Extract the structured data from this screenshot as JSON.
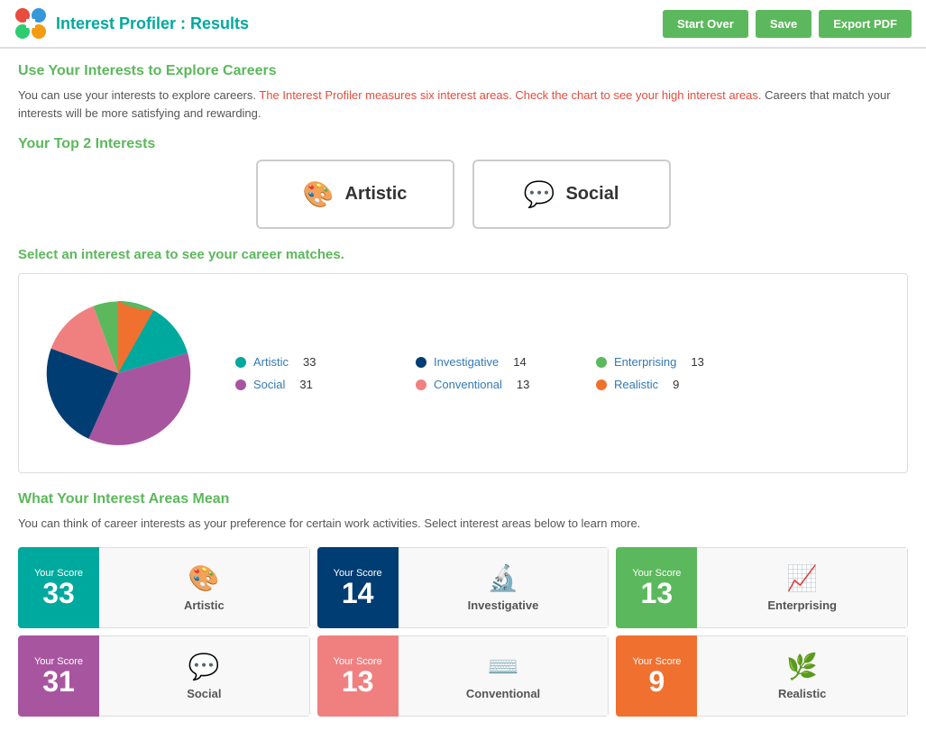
{
  "header": {
    "title": "Interest Profiler : Results",
    "buttons": {
      "start_over": "Start Over",
      "save": "Save",
      "export_pdf": "Export PDF"
    }
  },
  "intro": {
    "section_title": "Use Your Interests to Explore Careers",
    "description_plain": "You can use your interests to explore careers. ",
    "description_highlight": "The Interest Profiler measures six interest areas. Check the chart to see your high interest areas.",
    "description_end": " Careers that match your interests will be more satisfying and rewarding."
  },
  "top_interests": {
    "section_title": "Your Top 2 Interests",
    "items": [
      {
        "label": "Artistic",
        "icon": "🎨"
      },
      {
        "label": "Social",
        "icon": "💬"
      }
    ]
  },
  "select_label": "Select an interest area to see your career matches.",
  "chart": {
    "legend": [
      {
        "label": "Artistic",
        "value": 33,
        "color": "#00a99d"
      },
      {
        "label": "Social",
        "value": 31,
        "color": "#a855a0"
      },
      {
        "label": "Investigative",
        "value": 14,
        "color": "#003d73"
      },
      {
        "label": "Conventional",
        "value": 13,
        "color": "#f08080"
      },
      {
        "label": "Enterprising",
        "value": 13,
        "color": "#5cb85c"
      },
      {
        "label": "Realistic",
        "value": 9,
        "color": "#f07030"
      }
    ]
  },
  "interest_areas": {
    "section_title": "What Your Interest Areas Mean",
    "description": "You can think of career interests as your preference for certain work activities. Select interest areas below to learn more.",
    "tiles": [
      {
        "score_label": "Your Score",
        "score": 33,
        "label": "Artistic",
        "bg": "#00a99d",
        "icon": "🎨"
      },
      {
        "score_label": "Your Score",
        "score": 14,
        "label": "Investigative",
        "bg": "#003d73",
        "icon": "🔬"
      },
      {
        "score_label": "Your Score",
        "score": 13,
        "label": "Enterprising",
        "bg": "#5cb85c",
        "icon": "📈"
      },
      {
        "score_label": "Your Score",
        "score": 31,
        "label": "Social",
        "bg": "#a855a0",
        "icon": "💬"
      },
      {
        "score_label": "Your Score",
        "score": 13,
        "label": "Conventional",
        "bg": "#f08080",
        "icon": "⌨️"
      },
      {
        "score_label": "Your Score",
        "score": 9,
        "label": "Realistic",
        "bg": "#f07030",
        "icon": "🌿"
      }
    ]
  }
}
